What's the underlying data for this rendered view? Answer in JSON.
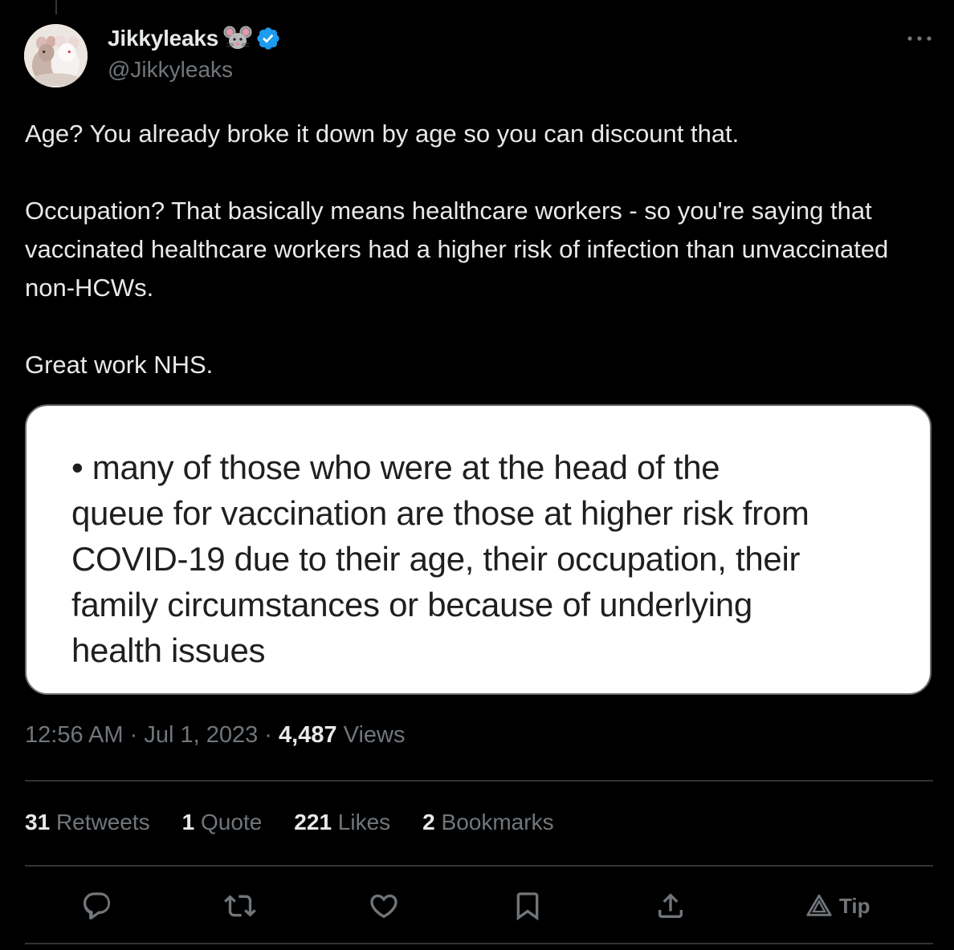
{
  "author": {
    "display_name": "Jikkyleaks",
    "handle": "@Jikkyleaks",
    "name_emoji": "mouse-face-icon",
    "verified_badge": "verified-badge-icon",
    "accent_color": "#1d9bf0"
  },
  "tweet": {
    "paragraphs": [
      "Age? You already broke it down by age so you can discount that.",
      "Occupation? That basically means healthcare workers - so you're saying that vaccinated healthcare workers had a higher risk of infection than unvaccinated non-HCWs.",
      "Great work NHS."
    ]
  },
  "media": {
    "lines": [
      "• many of those who were at the head of the",
      "queue for vaccination are those at higher risk from",
      "COVID-19 due to their age, their occupation, their",
      "family circumstances or because of underlying",
      "health issues"
    ]
  },
  "meta": {
    "time": "12:56 AM",
    "separator": "·",
    "date": "Jul 1, 2023",
    "views_count": "4,487",
    "views_label": "Views"
  },
  "stats": [
    {
      "count": "31",
      "label": "Retweets"
    },
    {
      "count": "1",
      "label": "Quote"
    },
    {
      "count": "221",
      "label": "Likes"
    },
    {
      "count": "2",
      "label": "Bookmarks"
    }
  ],
  "actions": {
    "reply": "reply-icon",
    "retweet": "retweet-icon",
    "like": "heart-icon",
    "bookmark": "bookmark-icon",
    "share": "share-icon",
    "tip_label": "Tip"
  },
  "colors": {
    "background": "#000000",
    "primary_text": "#e7e9ea",
    "secondary_text": "#71767b",
    "divider": "#2f3336"
  }
}
